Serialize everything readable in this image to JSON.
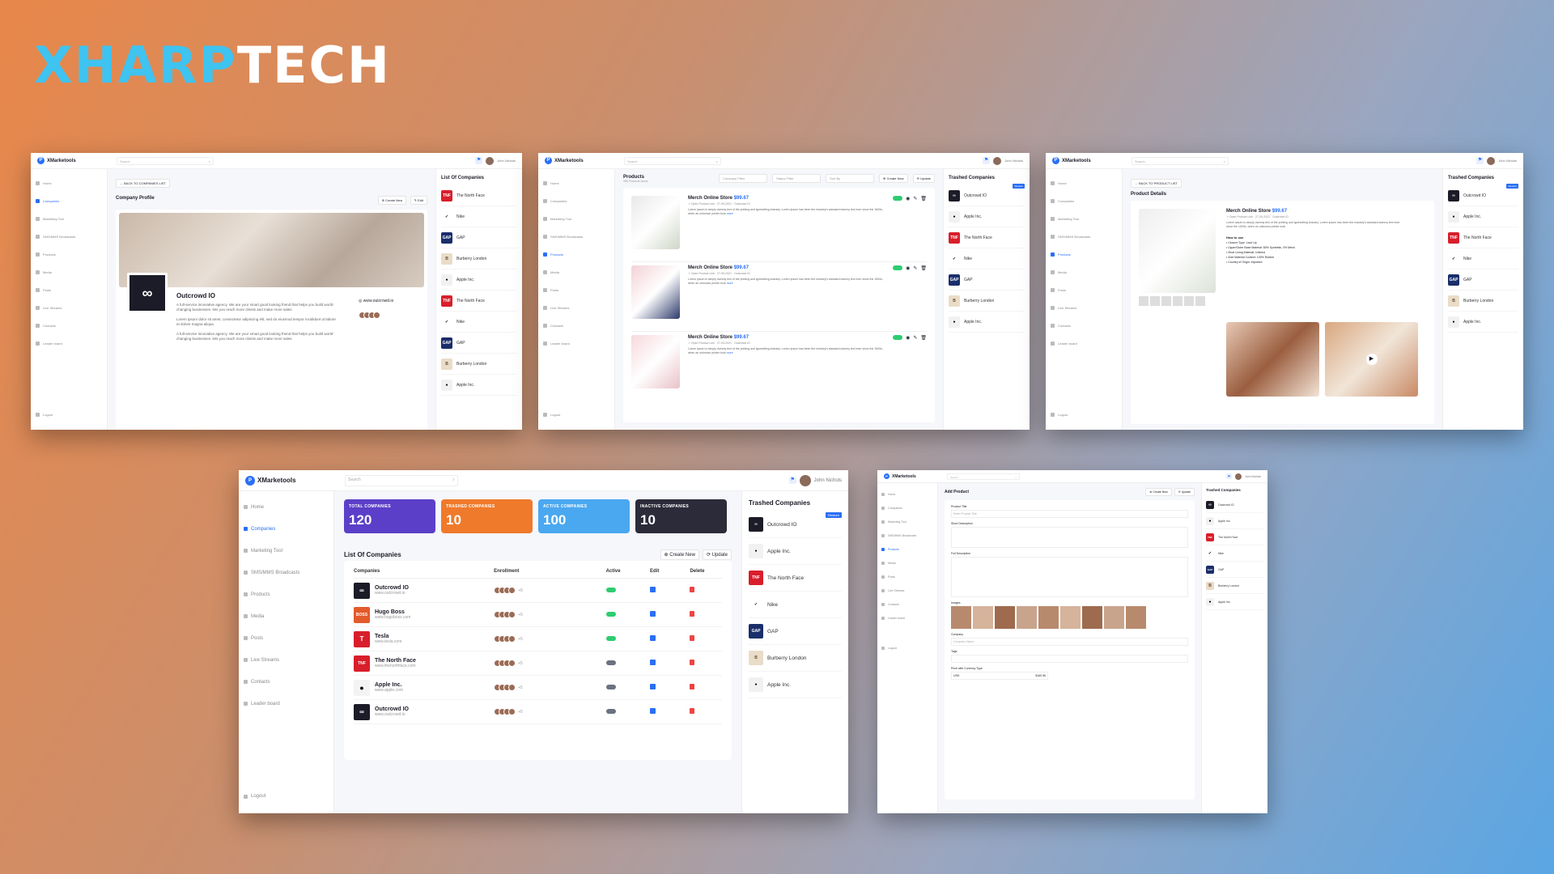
{
  "brand": {
    "part1": "XHARP",
    "part2": "TECH"
  },
  "app": {
    "name": "XMarketools",
    "search_placeholder": "Search",
    "user": "John Nichols"
  },
  "sidebar": [
    "Home",
    "Companies",
    "Marketing Tool",
    "SMS/MMS Broadcasts",
    "Products",
    "Media",
    "Posts",
    "Live Streams",
    "Contacts",
    "Leader board"
  ],
  "logout": "Logout",
  "shot1": {
    "back": "BACK TO COMPANIES LIST",
    "title": "Company Profile",
    "create": "Create New",
    "edit": "Edit",
    "company": "Outcrowd IO",
    "desc1": "A full-service innovative agency. We are your smart good looking friend that helps you build world-changing businesses. lets you reach more clients and make more sales.",
    "desc2": "Lorem ipsum dolor sit amet, consectetur adipiscing elit, sed do eiusmod tempor incididunt ut labore et dolore magna aliqua.",
    "desc3": "A full-service innovative agency. We are your smart good looking friend that helps you build world-changing businesses. lets you reach more clients and make more sales.",
    "website": "www.outcrowd.io",
    "list_title": "List Of Companies",
    "list": [
      "The North Face",
      "Nike",
      "GAP",
      "Burberry London",
      "Apple Inc.",
      "The North Face",
      "Nike",
      "GAP",
      "Burberry London",
      "Apple Inc."
    ]
  },
  "shot2": {
    "title": "Products",
    "sub": "285 Products found",
    "filters": [
      "Company Filter",
      "Status Filter",
      "Sort By"
    ],
    "create": "Create New",
    "update": "Update",
    "product": "Merch Online Store",
    "price": "$99.67",
    "link": "Open Product Link",
    "date": "27-09-2021",
    "company": "Outcrowd IO",
    "desc": "Lorem Ipsum is simply dummy text of the printing and typesetting industry. Lorem Ipsum has been the industry's standard dummy text ever since the 1500s, when an unknown printer took",
    "more": "more",
    "trashed_title": "Trashed Companies",
    "restore": "Restore",
    "trashed": [
      "Outcrowd IO",
      "Apple Inc.",
      "The North Face",
      "Nike",
      "GAP",
      "Burberry London",
      "Apple Inc."
    ]
  },
  "shot3": {
    "back": "BACK TO PRODUCT LIST",
    "title": "Product Details",
    "how": "How to use",
    "bullets": [
      "Closure Type: Lace Up",
      "Upper/Outer Base Material: 80% Synthetic, 0% Mesh",
      "Shoe Lining Material: Unlined",
      "Sole Material Content: 100% Rubber",
      "Country of Origin: Imported"
    ],
    "trashed": [
      "Outcrowd IO",
      "Apple Inc.",
      "The North Face",
      "Nike",
      "GAP",
      "Burberry London",
      "Apple Inc."
    ]
  },
  "shot4": {
    "stats": [
      {
        "label": "TOTAL COMPANIES",
        "value": "120",
        "color": "#5b3fc8"
      },
      {
        "label": "TRASHED COMPANIES",
        "value": "10",
        "color": "#f07a2b"
      },
      {
        "label": "ACTIVE COMPANIES",
        "value": "100",
        "color": "#4aa8f0"
      },
      {
        "label": "INACTIVE COMPANIES",
        "value": "10",
        "color": "#2b2b3a"
      }
    ],
    "list_title": "List Of Companies",
    "create": "Create New",
    "update": "Update",
    "headers": [
      "Companies",
      "Enrollment",
      "Active",
      "Edit",
      "Delete"
    ],
    "rows": [
      {
        "name": "Outcrowd IO",
        "url": "www.outcrowd.io",
        "more": "+5",
        "active": true,
        "color": "#1c1c28",
        "glyph": "∞"
      },
      {
        "name": "Hugo Boss",
        "url": "www.hugoboss.com",
        "more": "+5",
        "active": true,
        "color": "#e35a2b",
        "glyph": "BOSS"
      },
      {
        "name": "Tesla",
        "url": "www.tesla.com",
        "more": "+5",
        "active": true,
        "color": "#d91e2b",
        "glyph": "T"
      },
      {
        "name": "The North Face",
        "url": "www.thenorthface.com",
        "more": "+5",
        "active": false,
        "color": "#d91e2b",
        "glyph": "TNF"
      },
      {
        "name": "Apple Inc.",
        "url": "www.apple.com",
        "more": "+5",
        "active": false,
        "color": "#f3f3f3",
        "glyph": ""
      },
      {
        "name": "Outcrowd IO",
        "url": "www.outcrowd.io",
        "more": "+5",
        "active": false,
        "color": "#1c1c28",
        "glyph": "∞"
      }
    ],
    "trashed_title": "Trashed Companies",
    "restore": "Restore",
    "trashed": [
      "Outcrowd IO",
      "Apple Inc.",
      "The North Face",
      "Nike",
      "GAP",
      "Burberry London",
      "Apple Inc."
    ]
  },
  "shot5": {
    "title": "Add Product",
    "create": "Create New",
    "update": "Update",
    "f_title": "Product Title",
    "f_title_ph": "Enter Product Title",
    "f_short": "Short Description",
    "f_full": "Full Description",
    "f_images": "Images",
    "f_company": "Company",
    "f_company_ph": "Company Name",
    "f_tags": "Tags",
    "f_price": "Price with Currency Type",
    "currency": "USD",
    "price": "$160.56",
    "trashed_title": "Trashed Companies",
    "trashed": [
      "Outcrowd IO",
      "Apple Inc.",
      "The North Face",
      "Nike",
      "GAP",
      "Burberry London",
      "Apple Inc."
    ]
  }
}
